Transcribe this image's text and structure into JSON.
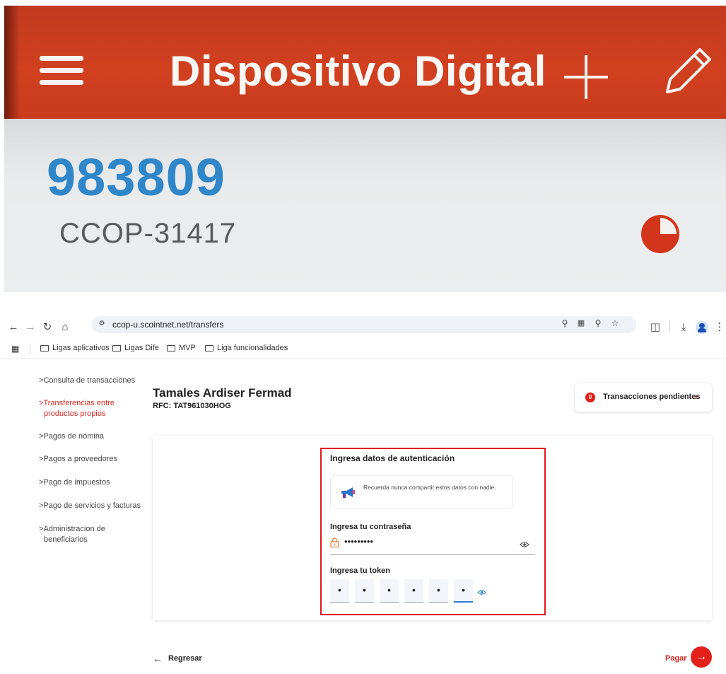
{
  "phone": {
    "title": "Dispositivo Digital",
    "code": "983809",
    "subtitle": "CCOP-31417",
    "colors": {
      "header": "#d1401f",
      "code": "#2f86c9"
    }
  },
  "browser": {
    "url": "ccop-u.scointnet.net/transfers",
    "bookmarks": [
      "Ligas aplicativos",
      "Ligas Dife",
      "MVP",
      "Liga funcionalidades"
    ]
  },
  "sidebar": {
    "items": [
      {
        "label": "Consulta de transacciones"
      },
      {
        "label": "Transferencias entre productos propios"
      },
      {
        "label": "Pagos de nómina"
      },
      {
        "label": "Pagos a proveedores"
      },
      {
        "label": "Pago de impuestos"
      },
      {
        "label": "Pago de servicios y facturas"
      },
      {
        "label": "Administracion de beneficiarios"
      }
    ],
    "chevron": ">"
  },
  "client": {
    "name": "Tamales Ardiser Fermad",
    "rfc": "RFC: TAT961030HOG"
  },
  "pending": {
    "count": "0",
    "label": "Transacciones pendientes"
  },
  "auth": {
    "title": "Ingresa datos de autenticación",
    "notice": "Recuerda nunca compartir estos datos con nadie.",
    "password_label": "Ingresa tu contraseña",
    "password_value": "•••••••••",
    "token_label": "Ingresa tu token",
    "token_digits": [
      "•",
      "•",
      "•",
      "•",
      "•",
      "•"
    ]
  },
  "footer": {
    "back": "Regresar",
    "pay": "Pagar"
  },
  "colors": {
    "accent": "#e41f1a",
    "active_sidebar": "#d7261f",
    "highlight_border": "#e0191f"
  }
}
